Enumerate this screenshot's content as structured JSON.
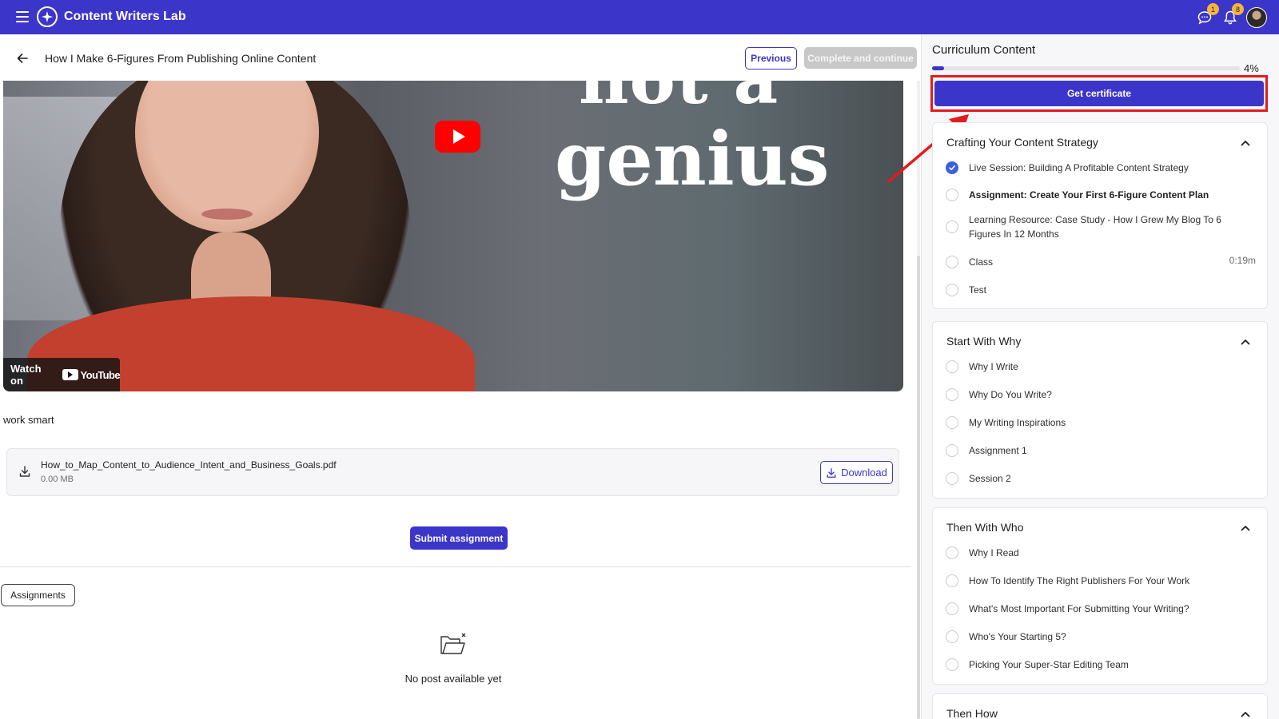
{
  "app": {
    "title": "Content Writers Lab"
  },
  "topbar": {
    "messages_badge": "1",
    "notifications_badge": "8"
  },
  "lesson": {
    "title": "How I Make 6-Figures From Publishing Online Content",
    "previous_label": "Previous",
    "complete_label": "Complete and continue",
    "description": "work smart"
  },
  "video": {
    "overlay_word_top": "not a",
    "overlay_word_main": "genius",
    "watch_on_label": "Watch on",
    "youtube_label": "YouTube"
  },
  "attachment": {
    "filename": "How_to_Map_Content_to_Audience_Intent_and_Business_Goals.pdf",
    "size": "0.00 MB",
    "download_label": "Download"
  },
  "submit_label": "Submit assignment",
  "tabs": {
    "assignments_label": "Assignments"
  },
  "empty_state": {
    "text": "No post available yet"
  },
  "sidebar": {
    "heading": "Curriculum Content",
    "progress_percent": 4,
    "progress_label": "4%",
    "certificate_label": "Get certificate",
    "sections": [
      {
        "title": "Crafting Your Content Strategy",
        "lessons": [
          {
            "label": "Live Session: Building A Profitable Content Strategy",
            "done": true
          },
          {
            "label": "Assignment: Create Your First 6-Figure Content Plan",
            "current": true
          },
          {
            "label": "Learning Resource: Case Study - How I Grew My Blog To 6 Figures In 12 Months"
          },
          {
            "label": "Class",
            "duration": "0:19m"
          },
          {
            "label": "Test"
          }
        ]
      },
      {
        "title": "Start With Why",
        "lessons": [
          {
            "label": "Why I Write"
          },
          {
            "label": "Why Do You Write?"
          },
          {
            "label": "My Writing Inspirations"
          },
          {
            "label": "Assignment 1"
          },
          {
            "label": "Session 2"
          }
        ]
      },
      {
        "title": "Then With Who",
        "lessons": [
          {
            "label": "Why I Read"
          },
          {
            "label": "How To Identify The Right Publishers For Your Work"
          },
          {
            "label": "What's Most Important For Submitting Your Writing?"
          },
          {
            "label": "Who's Your Starting 5?"
          },
          {
            "label": "Picking Your Super-Star Editing Team"
          }
        ]
      },
      {
        "title": "Then How",
        "lessons": []
      }
    ]
  },
  "colors": {
    "brand": "#3b35c9",
    "highlight": "#e21c1c",
    "badge": "#f4b53f",
    "done": "#3b5fe0"
  },
  "icons": [
    "menu-icon",
    "app-logo-icon",
    "chat-icon",
    "bell-icon",
    "back-arrow-icon",
    "download-icon",
    "folder-empty-icon",
    "chevron-up-icon",
    "check-icon",
    "youtube-play-icon"
  ]
}
